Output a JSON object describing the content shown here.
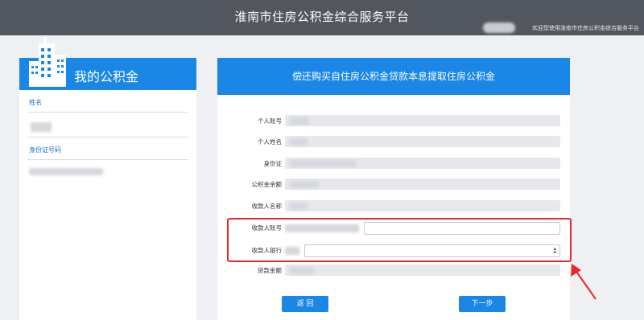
{
  "header": {
    "title": "淮南市住房公积金综合服务平台",
    "welcome": "欢迎您使用淮南市住房公积金综合服务平台"
  },
  "sidebar": {
    "title": "我的公积金",
    "fields": [
      {
        "label": "姓名"
      },
      {
        "label": "身份证号码"
      }
    ]
  },
  "form": {
    "title": "偿还购买自住房公积金贷款本息提取住房公积金",
    "rows": [
      {
        "label": "个人账号"
      },
      {
        "label": "个人姓名"
      },
      {
        "label": "身份证"
      },
      {
        "label": "公积金余额"
      },
      {
        "label": "收款人名称"
      },
      {
        "label": "收款人账号"
      },
      {
        "label": "收款人银行"
      },
      {
        "label": "贷款金额"
      }
    ],
    "back_label": "返 回",
    "next_label": "下一步"
  },
  "colors": {
    "accent": "#1a86e6",
    "topbar": "#52575f",
    "highlight": "#e8282c"
  }
}
